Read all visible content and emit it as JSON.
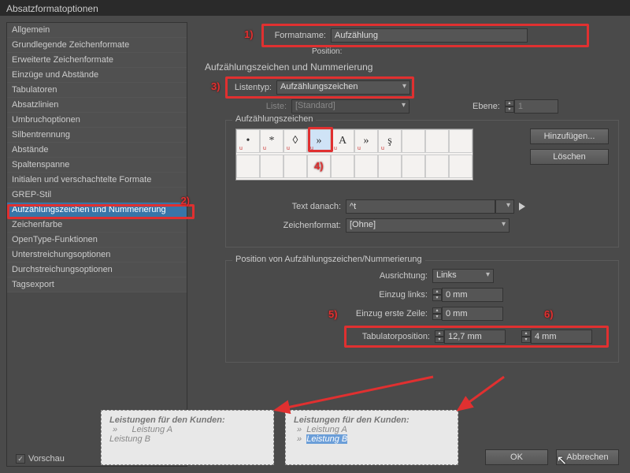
{
  "window": {
    "title": "Absatzformatoptionen"
  },
  "sidebar": {
    "items": [
      {
        "label": "Allgemein"
      },
      {
        "label": "Grundlegende Zeichenformate"
      },
      {
        "label": "Erweiterte Zeichenformate"
      },
      {
        "label": "Einzüge und Abstände"
      },
      {
        "label": "Tabulatoren"
      },
      {
        "label": "Absatzlinien"
      },
      {
        "label": "Umbruchoptionen"
      },
      {
        "label": "Silbentrennung"
      },
      {
        "label": "Abstände"
      },
      {
        "label": "Spaltenspanne"
      },
      {
        "label": "Initialen und verschachtelte Formate"
      },
      {
        "label": "GREP-Stil"
      },
      {
        "label": "Aufzählungszeichen und Nummerierung",
        "selected": true
      },
      {
        "label": "Zeichenfarbe"
      },
      {
        "label": "OpenType-Funktionen"
      },
      {
        "label": "Unterstreichungsoptionen"
      },
      {
        "label": "Durchstreichungsoptionen"
      },
      {
        "label": "Tagsexport"
      }
    ]
  },
  "annotations": {
    "a1": "1)",
    "a2": "2)",
    "a3": "3)",
    "a4": "4)",
    "a5": "5)",
    "a6": "6)"
  },
  "header": {
    "formatname_label": "Formatname:",
    "formatname_value": "Aufzählung",
    "position_label": "Position:",
    "section_title": "Aufzählungszeichen und Nummerierung"
  },
  "list": {
    "listentyp_label": "Listentyp:",
    "listentyp_value": "Aufzählungszeichen",
    "liste_label": "Liste:",
    "liste_value": "[Standard]",
    "ebene_label": "Ebene:",
    "ebene_value": "1"
  },
  "bullets": {
    "legend": "Aufzählungszeichen",
    "cells": [
      "•",
      "*",
      "◊",
      "»",
      "A",
      "»",
      "ş"
    ],
    "sel_index": 3,
    "add_btn": "Hinzufügen...",
    "del_btn": "Löschen"
  },
  "after": {
    "text_danach_label": "Text danach:",
    "text_danach_value": "^t",
    "zeichenformat_label": "Zeichenformat:",
    "zeichenformat_value": "[Ohne]"
  },
  "position": {
    "legend": "Position von Aufzählungszeichen/Nummerierung",
    "ausrichtung_label": "Ausrichtung:",
    "ausrichtung_value": "Links",
    "einzug_links_label": "Einzug links:",
    "einzug_links_value": "0 mm",
    "einzug_erste_label": "Einzug erste Zeile:",
    "einzug_erste_value": "0 mm",
    "tabulator_label": "Tabulatorposition:",
    "tabulator_value": "12,7 mm",
    "tabulator_value2": "4 mm"
  },
  "preview": {
    "checkbox": "Vorschau",
    "left": {
      "heading": "Leistungen für den Kunden:",
      "l1": "Leistung A",
      "l2": "Leistung B"
    },
    "right": {
      "heading": "Leistungen für den Kunden:",
      "l1": "Leistung A",
      "l2": "Leistung B"
    }
  },
  "footer": {
    "ok": "OK",
    "cancel": "Abbrechen"
  }
}
